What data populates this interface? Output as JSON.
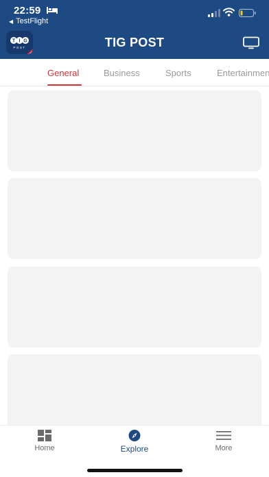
{
  "status_bar": {
    "time": "22:59",
    "back_app": "TestFlight",
    "icons": [
      "bed-icon",
      "signal-icon",
      "wifi-icon",
      "battery-icon"
    ]
  },
  "header": {
    "title": "TIG POST",
    "logo_text": "TIG POST",
    "right_icon": "tv-icon",
    "background": "#1e4a84"
  },
  "tabs": [
    {
      "label": "General",
      "active": true
    },
    {
      "label": "Business",
      "active": false
    },
    {
      "label": "Sports",
      "active": false
    },
    {
      "label": "Entertainment",
      "active": false
    }
  ],
  "accent": "#d0343a",
  "bottom_nav": [
    {
      "label": "Home",
      "icon": "grid-icon",
      "active": false
    },
    {
      "label": "Explore",
      "icon": "compass-icon",
      "active": true
    },
    {
      "label": "More",
      "icon": "menu-icon",
      "active": false
    }
  ]
}
